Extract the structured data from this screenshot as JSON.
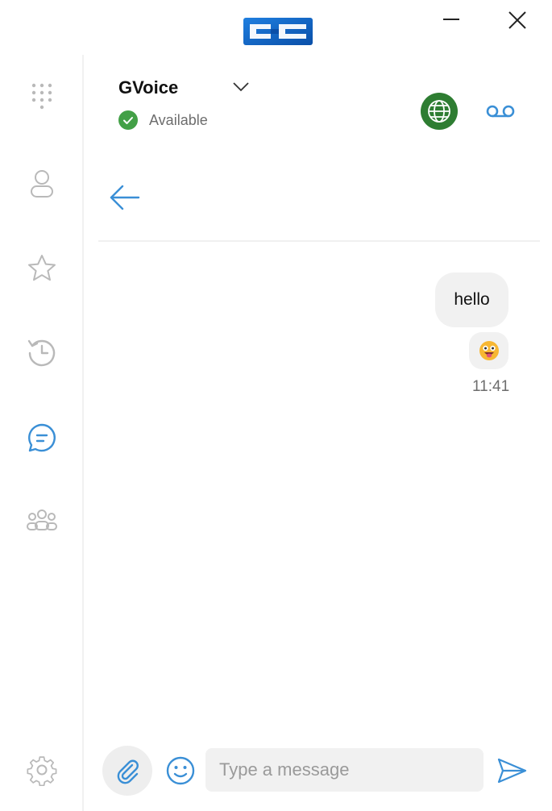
{
  "window": {
    "logo_icon": "cc-logo-icon",
    "minimize_icon": "minimize-icon",
    "close_icon": "close-icon"
  },
  "sidebar": {
    "items": [
      {
        "icon": "dialpad-icon",
        "active": false
      },
      {
        "icon": "contact-icon",
        "active": false
      },
      {
        "icon": "star-icon",
        "active": false
      },
      {
        "icon": "history-icon",
        "active": false
      },
      {
        "icon": "chat-icon",
        "active": true
      },
      {
        "icon": "group-icon",
        "active": false
      },
      {
        "icon": "gear-icon",
        "active": false
      }
    ]
  },
  "header": {
    "account_name": "GVoice",
    "status": "Available",
    "status_color": "#43a047",
    "globe_color": "#2e7d32"
  },
  "conversation": {
    "messages": [
      {
        "text": "hello",
        "emoji": "😛",
        "time": "11:41"
      }
    ]
  },
  "composer": {
    "placeholder": "Type a message",
    "value": ""
  },
  "colors": {
    "accent": "#3a8fd6",
    "icon_grey": "#b9b9b9"
  }
}
